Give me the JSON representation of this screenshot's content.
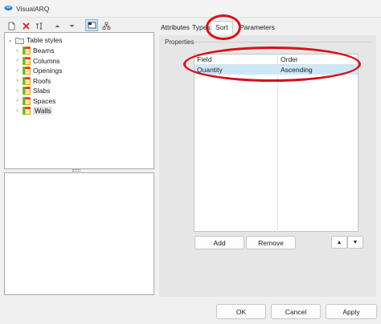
{
  "window": {
    "title": "VisualARQ"
  },
  "toolbar": {
    "items": [
      {
        "icon": "new-icon"
      },
      {
        "icon": "delete-icon"
      },
      {
        "icon": "rename-icon"
      },
      {
        "icon": "arrow-up-icon"
      },
      {
        "icon": "arrow-down-icon"
      },
      {
        "icon": "table-view-icon",
        "active": true
      },
      {
        "icon": "tree-view-icon"
      }
    ]
  },
  "tree": {
    "root": {
      "label": "Table styles",
      "expander": "⌄"
    },
    "items": [
      {
        "label": "Beams",
        "expander": "›"
      },
      {
        "label": "Columns",
        "expander": "›"
      },
      {
        "label": "Openings",
        "expander": "›"
      },
      {
        "label": "Roofs",
        "expander": "›"
      },
      {
        "label": "Slabs",
        "expander": "›"
      },
      {
        "label": "Spaces",
        "expander": "›"
      },
      {
        "label": "Walls",
        "expander": "›",
        "selected": true
      }
    ]
  },
  "tabs": [
    {
      "label": "Attributes"
    },
    {
      "label": "Types"
    },
    {
      "label": "Sort",
      "selected": true
    },
    {
      "label": "Parameters"
    }
  ],
  "properties": {
    "group_label": "Properties",
    "columns": [
      "Field",
      "Order"
    ],
    "rows": [
      {
        "field": "Quantity",
        "order": "Ascending"
      }
    ],
    "add_label": "Add",
    "remove_label": "Remove",
    "up_glyph": "▲",
    "down_glyph": "▼"
  },
  "footer": {
    "ok": "OK",
    "cancel": "Cancel",
    "apply": "Apply"
  },
  "colors": {
    "selection": "#cde8fb",
    "annotation": "#d8101a",
    "accent": "#0067c0"
  }
}
